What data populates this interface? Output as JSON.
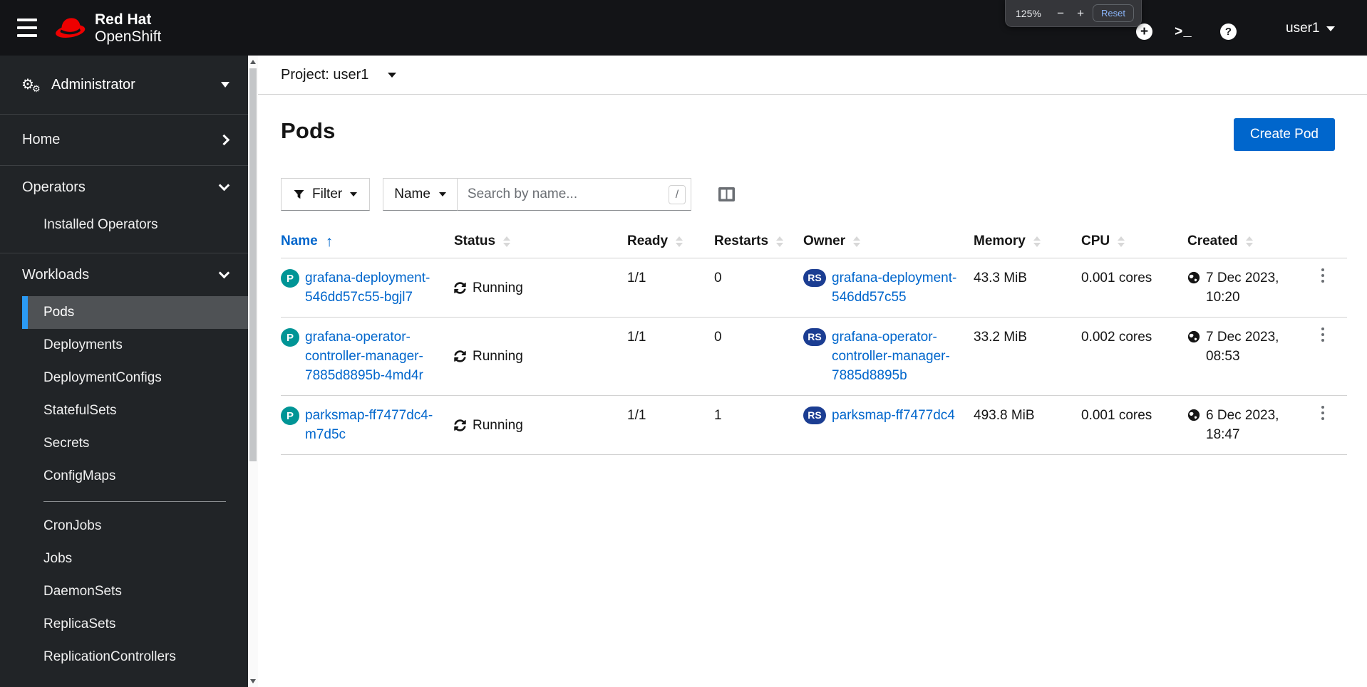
{
  "masthead": {
    "brand": {
      "line1": "Red Hat",
      "line2": "OpenShift"
    },
    "terminal_icon_label": ">_",
    "add_icon_label": "+",
    "help_icon_label": "?",
    "user_menu": "user1"
  },
  "zoom_popup": {
    "level": "125%",
    "minus_label": "−",
    "plus_label": "+",
    "reset_label": "Reset"
  },
  "sidebar": {
    "perspective": "Administrator",
    "home": "Home",
    "operators": {
      "label": "Operators",
      "children": [
        "Installed Operators"
      ]
    },
    "workloads": {
      "label": "Workloads",
      "active": "Pods",
      "children": [
        "Pods",
        "Deployments",
        "DeploymentConfigs",
        "StatefulSets",
        "Secrets",
        "ConfigMaps",
        "CronJobs",
        "Jobs",
        "DaemonSets",
        "ReplicaSets",
        "ReplicationControllers"
      ]
    }
  },
  "project_bar": {
    "label": "Project: user1"
  },
  "page": {
    "title": "Pods",
    "create_button": "Create Pod"
  },
  "toolbar": {
    "filter": "Filter",
    "attribute": "Name",
    "placeholder": "Search by name...",
    "shortcut": "/"
  },
  "table": {
    "columns": [
      "Name",
      "Status",
      "Ready",
      "Restarts",
      "Owner",
      "Memory",
      "CPU",
      "Created"
    ],
    "sorted_by": "Name",
    "sort_direction": "ascending",
    "rows": [
      {
        "badge": "P",
        "name": "grafana-deployment-546dd57c55-bgjl7",
        "status": "Running",
        "ready": "1/1",
        "restarts": "0",
        "owner_badge": "RS",
        "owner": "grafana-deployment-546dd57c55",
        "memory": "43.3 MiB",
        "cpu": "0.001 cores",
        "created": "7 Dec 2023, 10:20"
      },
      {
        "badge": "P",
        "name": "grafana-operator-controller-manager-7885d8895b-4md4r",
        "status": "Running",
        "ready": "1/1",
        "restarts": "0",
        "owner_badge": "RS",
        "owner": "grafana-operator-controller-manager-7885d8895b",
        "memory": "33.2 MiB",
        "cpu": "0.002 cores",
        "created": "7 Dec 2023, 08:53"
      },
      {
        "badge": "P",
        "name": "parksmap-ff7477dc4-m7d5c",
        "status": "Running",
        "ready": "1/1",
        "restarts": "1",
        "owner_badge": "RS",
        "owner": "parksmap-ff7477dc4",
        "memory": "493.8 MiB",
        "cpu": "0.001 cores",
        "created": "6 Dec 2023, 18:47"
      }
    ]
  },
  "colors": {
    "link": "#0066cc",
    "primary_button": "#0066cc",
    "pod_badge": "#009596",
    "owner_badge": "#1b3d92",
    "nav_active_indicator": "#2b9af3",
    "masthead_bg": "#131417",
    "sidebar_bg": "#212427",
    "zoom_reset_text": "#8ab4f8"
  }
}
